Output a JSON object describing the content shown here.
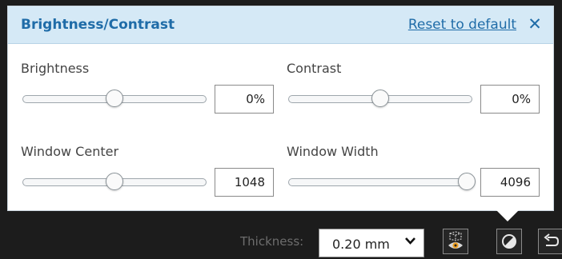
{
  "panel": {
    "title": "Brightness/Contrast",
    "reset_label": "Reset to default",
    "close_glyph": "✕",
    "controls": [
      {
        "label": "Brightness",
        "value": "0%",
        "level": 0.5
      },
      {
        "label": "Contrast",
        "value": "0%",
        "level": 0.5
      },
      {
        "label": "Window Center",
        "value": "1048",
        "level": 0.5
      },
      {
        "label": "Window Width",
        "value": "4096",
        "level": 0.97
      }
    ]
  },
  "toolbar": {
    "thickness_label": "Thickness:",
    "thickness_value": "0.20 mm",
    "dropdown_icon": "chevron-down-icon",
    "icons": [
      "volume-eye-icon",
      "contrast-icon",
      "undo-icon"
    ]
  },
  "colors": {
    "header_bg": "#d5e9f6",
    "accent": "#1f6ca8",
    "toolbar_bg": "#1c1c1c"
  }
}
